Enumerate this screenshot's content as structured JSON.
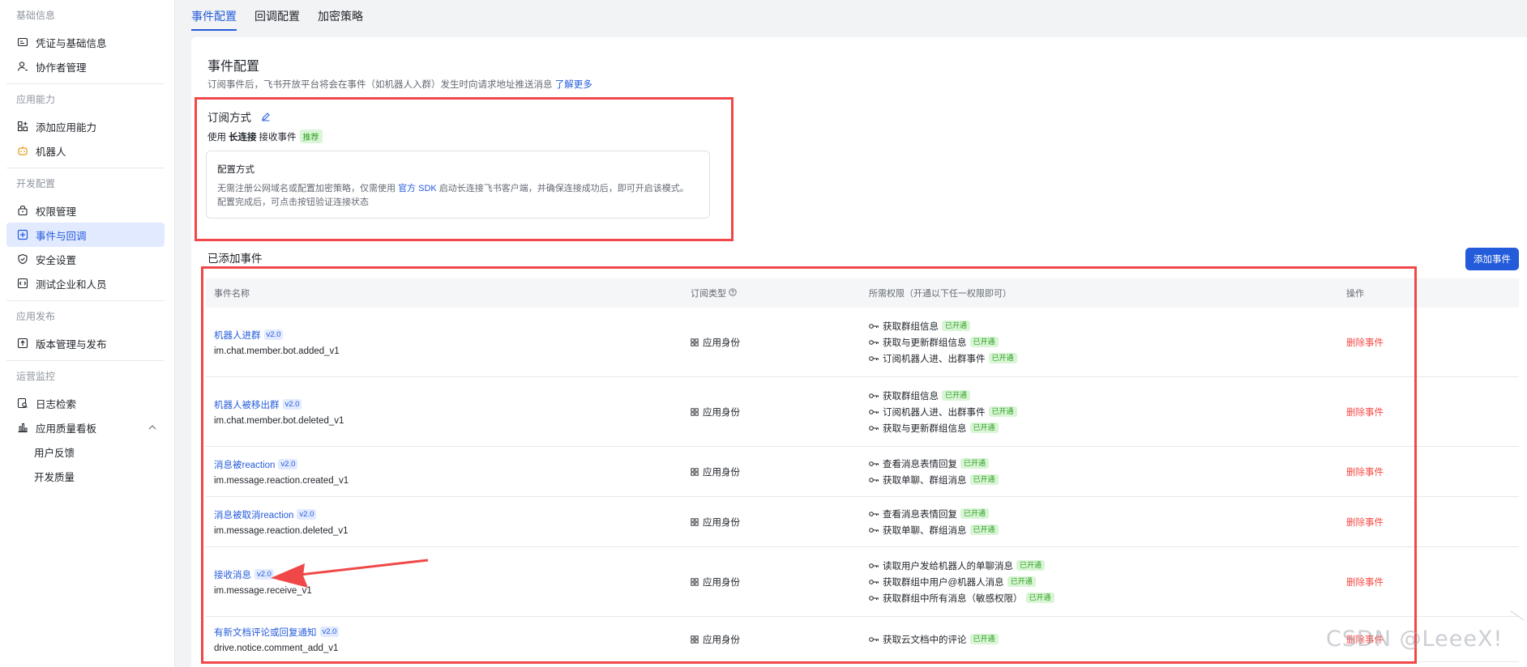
{
  "sidebar": {
    "groups": [
      {
        "title": "基础信息",
        "items": [
          {
            "label": "凭证与基础信息",
            "icon": "id-card-icon"
          },
          {
            "label": "协作者管理",
            "icon": "user-icon"
          }
        ]
      },
      {
        "title": "应用能力",
        "items": [
          {
            "label": "添加应用能力",
            "icon": "apps-add-icon"
          },
          {
            "label": "机器人",
            "icon": "robot-icon"
          }
        ]
      },
      {
        "title": "开发配置",
        "items": [
          {
            "label": "权限管理",
            "icon": "lock-icon"
          },
          {
            "label": "事件与回调",
            "icon": "event-icon"
          },
          {
            "label": "安全设置",
            "icon": "shield-icon"
          },
          {
            "label": "测试企业和人员",
            "icon": "code-icon"
          }
        ]
      },
      {
        "title": "应用发布",
        "items": [
          {
            "label": "版本管理与发布",
            "icon": "upload-icon"
          }
        ]
      },
      {
        "title": "运营监控",
        "items": [
          {
            "label": "日志检索",
            "icon": "log-search-icon"
          },
          {
            "label": "应用质量看板",
            "icon": "bar-chart-icon"
          },
          {
            "label": "用户反馈",
            "icon": ""
          },
          {
            "label": "开发质量",
            "icon": ""
          }
        ]
      }
    ],
    "active": "事件与回调"
  },
  "tabs": [
    "事件配置",
    "回调配置",
    "加密策略"
  ],
  "active_tab": "事件配置",
  "event_config": {
    "title": "事件配置",
    "desc": "订阅事件后，飞书开放平台将会在事件（如机器人入群）发生时向请求地址推送消息",
    "learn_more": "了解更多",
    "subscribe_title": "订阅方式",
    "subscribe_prefix": "使用",
    "subscribe_mode": "长连接",
    "subscribe_suffix": "接收事件",
    "recommend_badge": "推荐",
    "config_box": {
      "title": "配置方式",
      "line1_a": "无需注册公网域名或配置加密策略，仅需使用",
      "line1_link": "官方 SDK",
      "line1_b": "启动长连接飞书客户端，并确保连接成功后，即可开启该模式。",
      "line2": "配置完成后，可点击按钮验证连接状态"
    }
  },
  "added_events": {
    "title": "已添加事件",
    "add_button": "添加事件",
    "columns": [
      "事件名称",
      "订阅类型",
      "所需权限（开通以下任一权限即可）",
      "操作"
    ],
    "enabled_label": "已开通",
    "rows": [
      {
        "name": "机器人进群",
        "version": "v2.0",
        "code": "im.chat.member.bot.added_v1",
        "type": "应用身份",
        "perms": [
          "获取群组信息",
          "获取与更新群组信息",
          "订阅机器人进、出群事件"
        ],
        "action": "删除事件"
      },
      {
        "name": "机器人被移出群",
        "version": "v2.0",
        "code": "im.chat.member.bot.deleted_v1",
        "type": "应用身份",
        "perms": [
          "获取群组信息",
          "订阅机器人进、出群事件",
          "获取与更新群组信息"
        ],
        "action": "删除事件"
      },
      {
        "name": "消息被reaction",
        "version": "v2.0",
        "code": "im.message.reaction.created_v1",
        "type": "应用身份",
        "perms": [
          "查看消息表情回复",
          "获取单聊、群组消息"
        ],
        "action": "删除事件"
      },
      {
        "name": "消息被取消reaction",
        "version": "v2.0",
        "code": "im.message.reaction.deleted_v1",
        "type": "应用身份",
        "perms": [
          "查看消息表情回复",
          "获取单聊、群组消息"
        ],
        "action": "删除事件"
      },
      {
        "name": "接收消息",
        "version": "v2.0",
        "code": "im.message.receive_v1",
        "type": "应用身份",
        "perms": [
          "读取用户发给机器人的单聊消息",
          "获取群组中用户@机器人消息",
          "获取群组中所有消息（敏感权限）"
        ],
        "action": "删除事件"
      },
      {
        "name": "有新文档评论或回复通知",
        "version": "v2.0",
        "code": "drive.notice.comment_add_v1",
        "type": "应用身份",
        "perms": [
          "获取云文档中的评论"
        ],
        "action": "删除事件"
      }
    ]
  },
  "watermark": "CSDN @LeeeX!",
  "colors": {
    "accent": "#245bdb",
    "danger": "#f54a45",
    "highlight": "#f04848",
    "success": "#2ea121"
  }
}
